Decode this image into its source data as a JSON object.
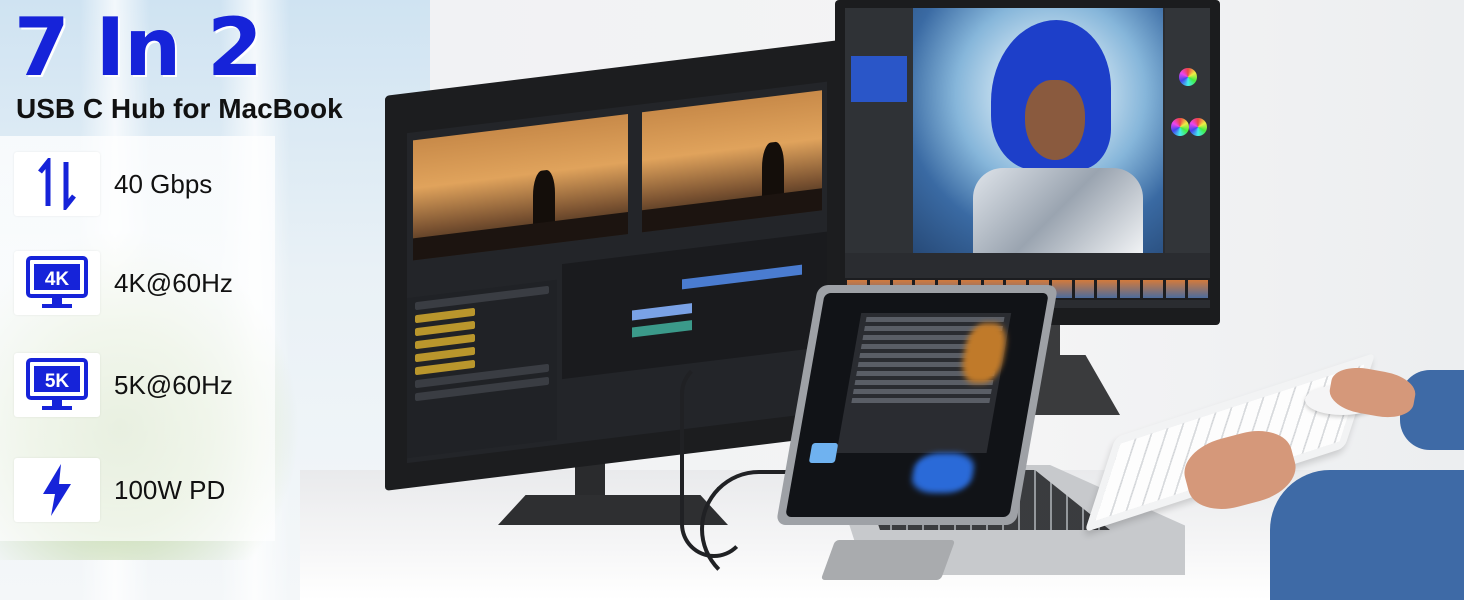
{
  "headline": "7 In 2",
  "subheadline": "USB C Hub for MacBook",
  "features": [
    {
      "icon": "arrows-up-down-icon",
      "label": "40 Gbps"
    },
    {
      "icon": "4k-monitor-icon",
      "badge": "4K",
      "label": "4K@60Hz"
    },
    {
      "icon": "5k-monitor-icon",
      "badge": "5K",
      "label": "5K@60Hz"
    },
    {
      "icon": "lightning-icon",
      "label": "100W PD"
    }
  ],
  "colors": {
    "accent": "#1623d9"
  }
}
